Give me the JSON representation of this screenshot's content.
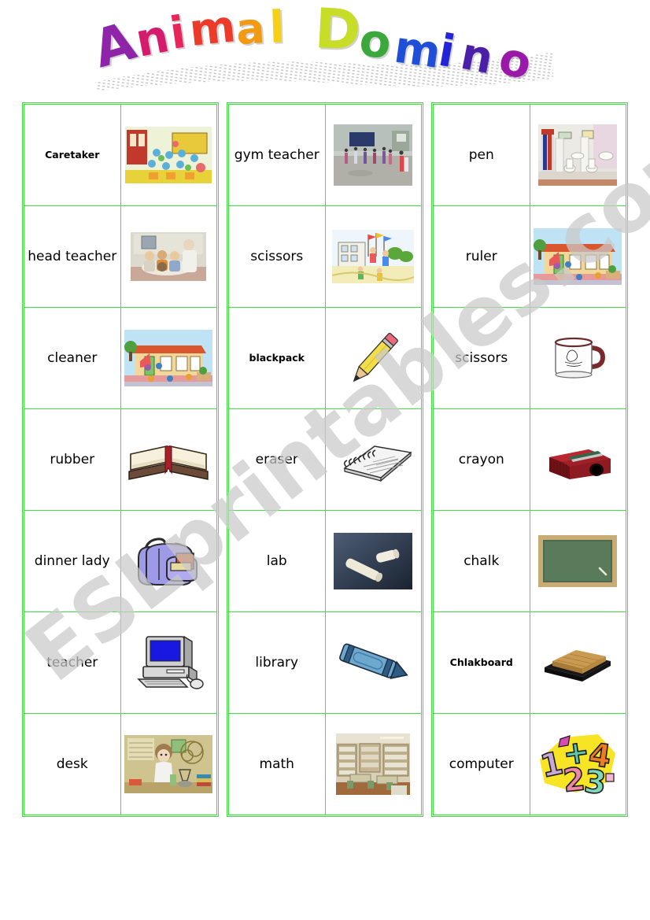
{
  "title": {
    "word1": "Animal",
    "word2": "Domino",
    "word1_letters": [
      "A",
      "n",
      "i",
      "m",
      "a",
      "l"
    ],
    "word2_letters": [
      "D",
      "o",
      "m",
      "i",
      "n",
      "o"
    ],
    "word1_colors": [
      "#8e25a8",
      "#d61a6e",
      "#e8265a",
      "#ec3b2a",
      "#f29a12",
      "#f5d017"
    ],
    "word2_colors": [
      "#c8dd28",
      "#3aa83a",
      "#1f4fd8",
      "#2323d8",
      "#4b1fa8",
      "#9b19a8"
    ]
  },
  "watermark": {
    "text": "ESLprintables.com",
    "color": "#c9c9c9"
  },
  "theme": {
    "border_color": "#3fe03f",
    "text_color": "#000000",
    "background": "#ffffff"
  },
  "columns": [
    {
      "name": "left-column",
      "rows": [
        {
          "word": "Caretaker",
          "small": true,
          "image": "classroom-crowd-illustration"
        },
        {
          "word": "head teacher",
          "small": false,
          "image": "teacher-with-children-photo"
        },
        {
          "word": "cleaner",
          "small": false,
          "image": "school-building-illustration"
        },
        {
          "word": "rubber",
          "small": false,
          "image": "open-book-illustration"
        },
        {
          "word": "dinner lady",
          "small": false,
          "image": "purple-backpack-illustration"
        },
        {
          "word": "teacher",
          "small": false,
          "image": "desktop-computer-illustration"
        },
        {
          "word": "desk",
          "small": false,
          "image": "science-lab-child-illustration"
        }
      ]
    },
    {
      "name": "middle-column",
      "rows": [
        {
          "word": "gym teacher",
          "small": false,
          "image": "school-gym-photo"
        },
        {
          "word": "scissors",
          "small": false,
          "image": "school-playground-illustration"
        },
        {
          "word": "blackpack",
          "small": true,
          "image": "yellow-pencil-illustration"
        },
        {
          "word": "eraser",
          "small": false,
          "image": "spiral-notebook-illustration"
        },
        {
          "word": "lab",
          "small": false,
          "image": "chalk-sticks-photo"
        },
        {
          "word": "library",
          "small": false,
          "image": "blue-crayon-illustration"
        },
        {
          "word": "math",
          "small": false,
          "image": "library-room-photo"
        }
      ]
    },
    {
      "name": "right-column",
      "rows": [
        {
          "word": "pen",
          "small": false,
          "image": "school-toilets-photo"
        },
        {
          "word": "ruler",
          "small": false,
          "image": "school-building-illustration"
        },
        {
          "word": "scissors",
          "small": false,
          "image": "white-mug-illustration"
        },
        {
          "word": "crayon",
          "small": false,
          "image": "red-pencil-sharpener-photo"
        },
        {
          "word": "chalk",
          "small": false,
          "image": "green-chalkboard-photo"
        },
        {
          "word": "Chlakboard",
          "small": true,
          "image": "board-eraser-photo"
        },
        {
          "word": "computer",
          "small": false,
          "image": "colorful-numbers-illustration"
        }
      ]
    }
  ]
}
